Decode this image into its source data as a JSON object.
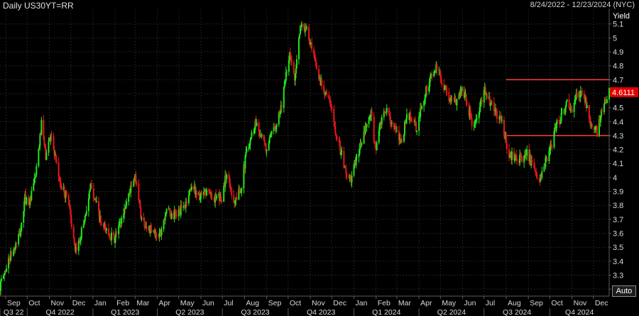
{
  "header": {
    "title": "Daily US30YT=RR",
    "date_range": "8/24/2022 - 12/23/2024 (NYC)"
  },
  "controls": {
    "auto_label": "Auto"
  },
  "colors": {
    "background": "#000000",
    "grid": "#3a3a3a",
    "up": "#22e61a",
    "down": "#e6181a",
    "level_line": "#ff3b3b",
    "price_label_bg": "#e00000",
    "axis_text": "#d8d8d8",
    "separator": "#5a5a5a"
  },
  "chart_data": {
    "type": "candlestick",
    "yaxis_title": "Yield",
    "ylim": [
      3.15,
      5.2
    ],
    "yticks": [
      3.2,
      3.3,
      3.4,
      3.5,
      3.6,
      3.7,
      3.8,
      3.9,
      4.0,
      4.1,
      4.2,
      4.3,
      4.4,
      4.5,
      4.6,
      4.7,
      4.8,
      4.9,
      5.0,
      5.1
    ],
    "ytick_labels": [
      "3.2",
      "3.3",
      "3.4",
      "3.5",
      "3.6",
      "3.7",
      "3.8",
      "3.9",
      "4",
      "4.1",
      "4.2",
      "4.3",
      "4.4",
      "4.5",
      "4.6",
      "4.7",
      "4.8",
      "4.9",
      "5",
      "5.1"
    ],
    "xlim": [
      "2022-08-24",
      "2024-12-23"
    ],
    "months": [
      {
        "label": "Sep",
        "date": "2022-09-01"
      },
      {
        "label": "Oct",
        "date": "2022-10-01"
      },
      {
        "label": "Nov",
        "date": "2022-11-01"
      },
      {
        "label": "Dec",
        "date": "2022-12-01"
      },
      {
        "label": "Jan",
        "date": "2023-01-01"
      },
      {
        "label": "Feb",
        "date": "2023-02-01"
      },
      {
        "label": "Mar",
        "date": "2023-03-01"
      },
      {
        "label": "Apr",
        "date": "2023-04-01"
      },
      {
        "label": "May",
        "date": "2023-05-01"
      },
      {
        "label": "Jun",
        "date": "2023-06-01"
      },
      {
        "label": "Jul",
        "date": "2023-07-01"
      },
      {
        "label": "Aug",
        "date": "2023-08-01"
      },
      {
        "label": "Sep",
        "date": "2023-09-01"
      },
      {
        "label": "Oct",
        "date": "2023-10-01"
      },
      {
        "label": "Nov",
        "date": "2023-11-01"
      },
      {
        "label": "Dec",
        "date": "2023-12-01"
      },
      {
        "label": "Jan",
        "date": "2024-01-01"
      },
      {
        "label": "Feb",
        "date": "2024-02-01"
      },
      {
        "label": "Mar",
        "date": "2024-03-01"
      },
      {
        "label": "Apr",
        "date": "2024-04-01"
      },
      {
        "label": "May",
        "date": "2024-05-01"
      },
      {
        "label": "Jun",
        "date": "2024-06-01"
      },
      {
        "label": "Jul",
        "date": "2024-07-01"
      },
      {
        "label": "Aug",
        "date": "2024-08-01"
      },
      {
        "label": "Sep",
        "date": "2024-09-01"
      },
      {
        "label": "Oct",
        "date": "2024-10-01"
      },
      {
        "label": "Nov",
        "date": "2024-11-01"
      },
      {
        "label": "Dec",
        "date": "2024-12-01"
      }
    ],
    "quarters": [
      {
        "label": "Q3 22",
        "start": "2022-08-24",
        "end": "2022-10-01"
      },
      {
        "label": "Q4 2022",
        "start": "2022-10-01",
        "end": "2023-01-01"
      },
      {
        "label": "Q1 2023",
        "start": "2023-01-01",
        "end": "2023-04-01"
      },
      {
        "label": "Q2 2023",
        "start": "2023-04-01",
        "end": "2023-07-01"
      },
      {
        "label": "Q3 2023",
        "start": "2023-07-01",
        "end": "2023-10-01"
      },
      {
        "label": "Q4 2023",
        "start": "2023-10-01",
        "end": "2024-01-01"
      },
      {
        "label": "Q1 2024",
        "start": "2024-01-01",
        "end": "2024-04-01"
      },
      {
        "label": "Q2 2024",
        "start": "2024-04-01",
        "end": "2024-07-01"
      },
      {
        "label": "Q3 2024",
        "start": "2024-07-01",
        "end": "2024-10-01"
      },
      {
        "label": "Q4 2024",
        "start": "2024-10-01",
        "end": "2024-12-23"
      }
    ],
    "path": [
      [
        "2022-08-24",
        3.22
      ],
      [
        "2022-09-06",
        3.42
      ],
      [
        "2022-09-14",
        3.5
      ],
      [
        "2022-09-22",
        3.62
      ],
      [
        "2022-09-28",
        3.85
      ],
      [
        "2022-10-05",
        3.82
      ],
      [
        "2022-10-14",
        4.05
      ],
      [
        "2022-10-21",
        4.38
      ],
      [
        "2022-10-27",
        4.15
      ],
      [
        "2022-11-03",
        4.32
      ],
      [
        "2022-11-10",
        4.1
      ],
      [
        "2022-11-18",
        3.92
      ],
      [
        "2022-11-28",
        3.85
      ],
      [
        "2022-12-07",
        3.45
      ],
      [
        "2022-12-13",
        3.55
      ],
      [
        "2022-12-20",
        3.7
      ],
      [
        "2022-12-30",
        3.95
      ],
      [
        "2023-01-06",
        3.8
      ],
      [
        "2023-01-13",
        3.65
      ],
      [
        "2023-01-20",
        3.62
      ],
      [
        "2023-01-31",
        3.55
      ],
      [
        "2023-02-10",
        3.7
      ],
      [
        "2023-02-21",
        3.9
      ],
      [
        "2023-03-02",
        4.0
      ],
      [
        "2023-03-10",
        3.7
      ],
      [
        "2023-03-17",
        3.65
      ],
      [
        "2023-03-24",
        3.6
      ],
      [
        "2023-04-05",
        3.6
      ],
      [
        "2023-04-14",
        3.78
      ],
      [
        "2023-04-21",
        3.72
      ],
      [
        "2023-05-01",
        3.75
      ],
      [
        "2023-05-10",
        3.8
      ],
      [
        "2023-05-19",
        3.95
      ],
      [
        "2023-05-31",
        3.85
      ],
      [
        "2023-06-09",
        3.9
      ],
      [
        "2023-06-20",
        3.85
      ],
      [
        "2023-06-30",
        3.85
      ],
      [
        "2023-07-07",
        4.04
      ],
      [
        "2023-07-18",
        3.82
      ],
      [
        "2023-07-28",
        3.95
      ],
      [
        "2023-08-04",
        4.2
      ],
      [
        "2023-08-17",
        4.4
      ],
      [
        "2023-08-31",
        4.2
      ],
      [
        "2023-09-08",
        4.3
      ],
      [
        "2023-09-21",
        4.5
      ],
      [
        "2023-10-03",
        4.88
      ],
      [
        "2023-10-10",
        4.72
      ],
      [
        "2023-10-19",
        5.1
      ],
      [
        "2023-10-27",
        5.05
      ],
      [
        "2023-11-06",
        4.85
      ],
      [
        "2023-11-14",
        4.7
      ],
      [
        "2023-11-22",
        4.62
      ],
      [
        "2023-11-30",
        4.5
      ],
      [
        "2023-12-08",
        4.3
      ],
      [
        "2023-12-20",
        4.05
      ],
      [
        "2023-12-27",
        3.97
      ],
      [
        "2024-01-05",
        4.15
      ],
      [
        "2024-01-12",
        4.25
      ],
      [
        "2024-01-19",
        4.38
      ],
      [
        "2024-01-25",
        4.45
      ],
      [
        "2024-01-31",
        4.2
      ],
      [
        "2024-02-07",
        4.38
      ],
      [
        "2024-02-15",
        4.48
      ],
      [
        "2024-02-23",
        4.4
      ],
      [
        "2024-03-01",
        4.3
      ],
      [
        "2024-03-08",
        4.26
      ],
      [
        "2024-03-15",
        4.45
      ],
      [
        "2024-03-22",
        4.42
      ],
      [
        "2024-03-29",
        4.34
      ],
      [
        "2024-04-05",
        4.52
      ],
      [
        "2024-04-16",
        4.7
      ],
      [
        "2024-04-25",
        4.78
      ],
      [
        "2024-05-01",
        4.72
      ],
      [
        "2024-05-09",
        4.62
      ],
      [
        "2024-05-15",
        4.55
      ],
      [
        "2024-05-23",
        4.55
      ],
      [
        "2024-05-31",
        4.64
      ],
      [
        "2024-06-07",
        4.55
      ],
      [
        "2024-06-14",
        4.38
      ],
      [
        "2024-06-21",
        4.4
      ],
      [
        "2024-06-28",
        4.56
      ],
      [
        "2024-07-03",
        4.62
      ],
      [
        "2024-07-11",
        4.52
      ],
      [
        "2024-07-19",
        4.45
      ],
      [
        "2024-07-26",
        4.4
      ],
      [
        "2024-08-05",
        4.15
      ],
      [
        "2024-08-14",
        4.16
      ],
      [
        "2024-08-23",
        4.12
      ],
      [
        "2024-08-30",
        4.2
      ],
      [
        "2024-09-06",
        4.08
      ],
      [
        "2024-09-13",
        3.99
      ],
      [
        "2024-09-18",
        4.0
      ],
      [
        "2024-09-26",
        4.12
      ],
      [
        "2024-10-03",
        4.22
      ],
      [
        "2024-10-10",
        4.38
      ],
      [
        "2024-10-18",
        4.45
      ],
      [
        "2024-10-25",
        4.53
      ],
      [
        "2024-11-01",
        4.45
      ],
      [
        "2024-11-06",
        4.58
      ],
      [
        "2024-11-15",
        4.6
      ],
      [
        "2024-11-22",
        4.52
      ],
      [
        "2024-11-29",
        4.35
      ],
      [
        "2024-12-06",
        4.33
      ],
      [
        "2024-12-12",
        4.45
      ],
      [
        "2024-12-18",
        4.55
      ],
      [
        "2024-12-23",
        4.61
      ]
    ],
    "horizontal_levels": [
      {
        "value": 4.7,
        "from": "2024-08-01",
        "to": "2024-12-23"
      },
      {
        "value": 4.3,
        "from": "2024-08-01",
        "to": "2024-12-23"
      }
    ],
    "last_price_label": "4.6111",
    "last_price": 4.6111,
    "grid": true
  }
}
